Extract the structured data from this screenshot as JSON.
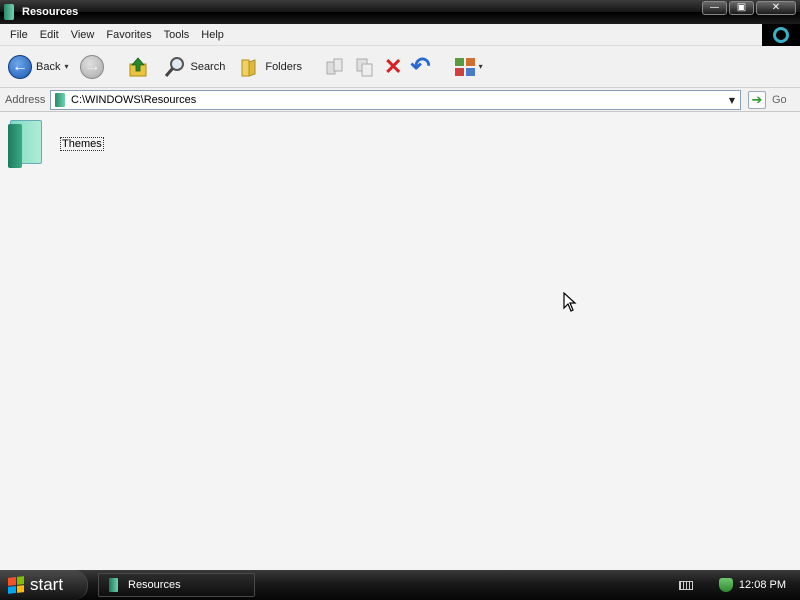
{
  "window": {
    "title": "Resources",
    "buttons": {
      "minimize": "—",
      "maximize": "▣",
      "close": "✕"
    }
  },
  "menu": [
    "File",
    "Edit",
    "View",
    "Favorites",
    "Tools",
    "Help"
  ],
  "toolbar": {
    "back_label": "Back",
    "search_label": "Search",
    "folders_label": "Folders",
    "dropdown_glyph": "▾",
    "back_glyph": "←",
    "forward_glyph": "→",
    "delete_glyph": "✕",
    "undo_glyph": "↶"
  },
  "address": {
    "label": "Address",
    "value": "C:\\WINDOWS\\Resources",
    "dropdown_glyph": "▼",
    "go_label": "Go",
    "go_glyph": "➔"
  },
  "content": {
    "items": [
      {
        "name": "Themes",
        "type": "folder"
      }
    ]
  },
  "taskbar": {
    "start_label": "start",
    "task_label": "Resources",
    "clock": "12:08 PM"
  },
  "colors": {
    "accent": "#1a56b4",
    "folder": "#3aaa86",
    "delete": "#d82020",
    "undo": "#2a6ad0"
  }
}
